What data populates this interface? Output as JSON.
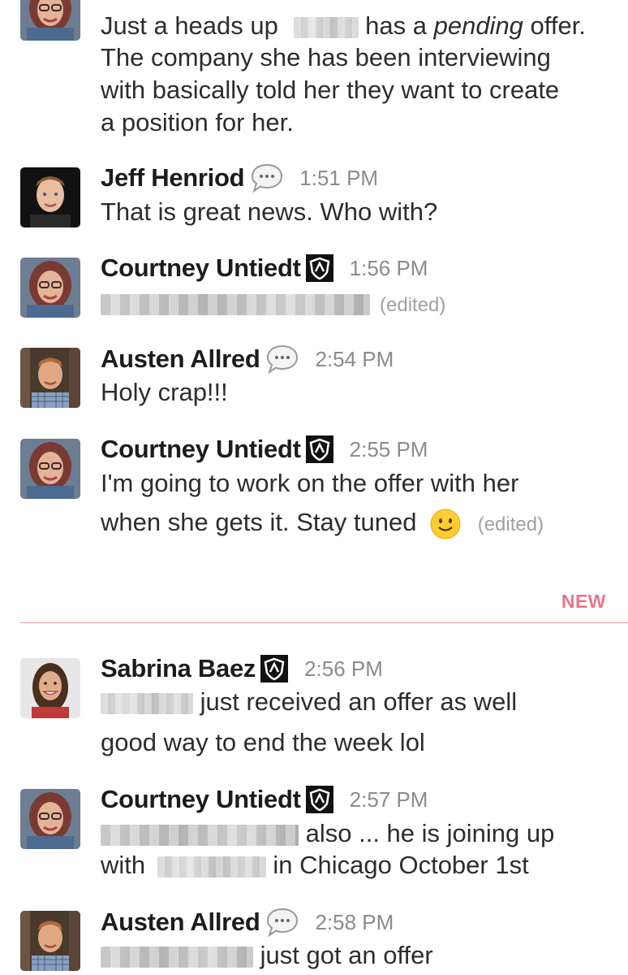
{
  "colors": {
    "new_divider": "#e8768a",
    "timestamp": "#8b8b8b",
    "name": "#1d1c1d",
    "text": "#2c2d30"
  },
  "messages": [
    {
      "id": "m0",
      "author": "Courtney Untiedt",
      "avatar": "avatar-courtney",
      "lines": [
        {
          "pre": "Just a heads up",
          "redacted": true,
          "post_plain": " has a ",
          "post_italic": "pending",
          "post_end": " offer."
        },
        {
          "text": "The company she has been interviewing"
        },
        {
          "text": " with basically told her they want to create"
        },
        {
          "text": "a position for her."
        }
      ]
    },
    {
      "id": "m1",
      "author": "Jeff Henriod",
      "badge": "speech-bubble-icon",
      "time": "1:51 PM",
      "lines": [
        {
          "text": "That is great news. Who with?"
        }
      ]
    },
    {
      "id": "m2",
      "author": "Courtney Untiedt",
      "badge": "shield-badge-icon",
      "time": "1:56 PM",
      "lines": [
        {
          "redacted": true,
          "edited": "(edited)"
        }
      ]
    },
    {
      "id": "m3",
      "author": "Austen Allred",
      "badge": "speech-bubble-icon",
      "time": "2:54 PM",
      "lines": [
        {
          "text": "Holy crap!!!"
        }
      ]
    },
    {
      "id": "m4",
      "author": "Courtney Untiedt",
      "badge": "shield-badge-icon",
      "time": "2:55 PM",
      "lines": [
        {
          "text": "I'm going to work on the offer with her"
        },
        {
          "text": "when she gets it. Stay tuned",
          "emoji": "slightly-smiling-face-icon",
          "edited": "(edited)"
        }
      ]
    },
    {
      "id": "m5",
      "author": "Sabrina Baez",
      "badge": "shield-badge-icon",
      "time": "2:56 PM",
      "lines": [
        {
          "redacted": true,
          "text": " just received an offer as well"
        },
        {
          "text": "good way to end the week lol"
        }
      ]
    },
    {
      "id": "m6",
      "author": "Courtney Untiedt",
      "badge": "shield-badge-icon",
      "time": "2:57 PM",
      "lines": [
        {
          "redacted": true,
          "text": " also ... he is joining up"
        },
        {
          "pre": "with",
          "redacted": true,
          "text": " in Chicago October 1st"
        }
      ]
    },
    {
      "id": "m7",
      "author": "Austen Allred",
      "badge": "speech-bubble-icon",
      "time": "2:58 PM",
      "lines": [
        {
          "redacted": true,
          "text": " just got an offer"
        }
      ]
    }
  ],
  "divider": {
    "label": "NEW"
  }
}
